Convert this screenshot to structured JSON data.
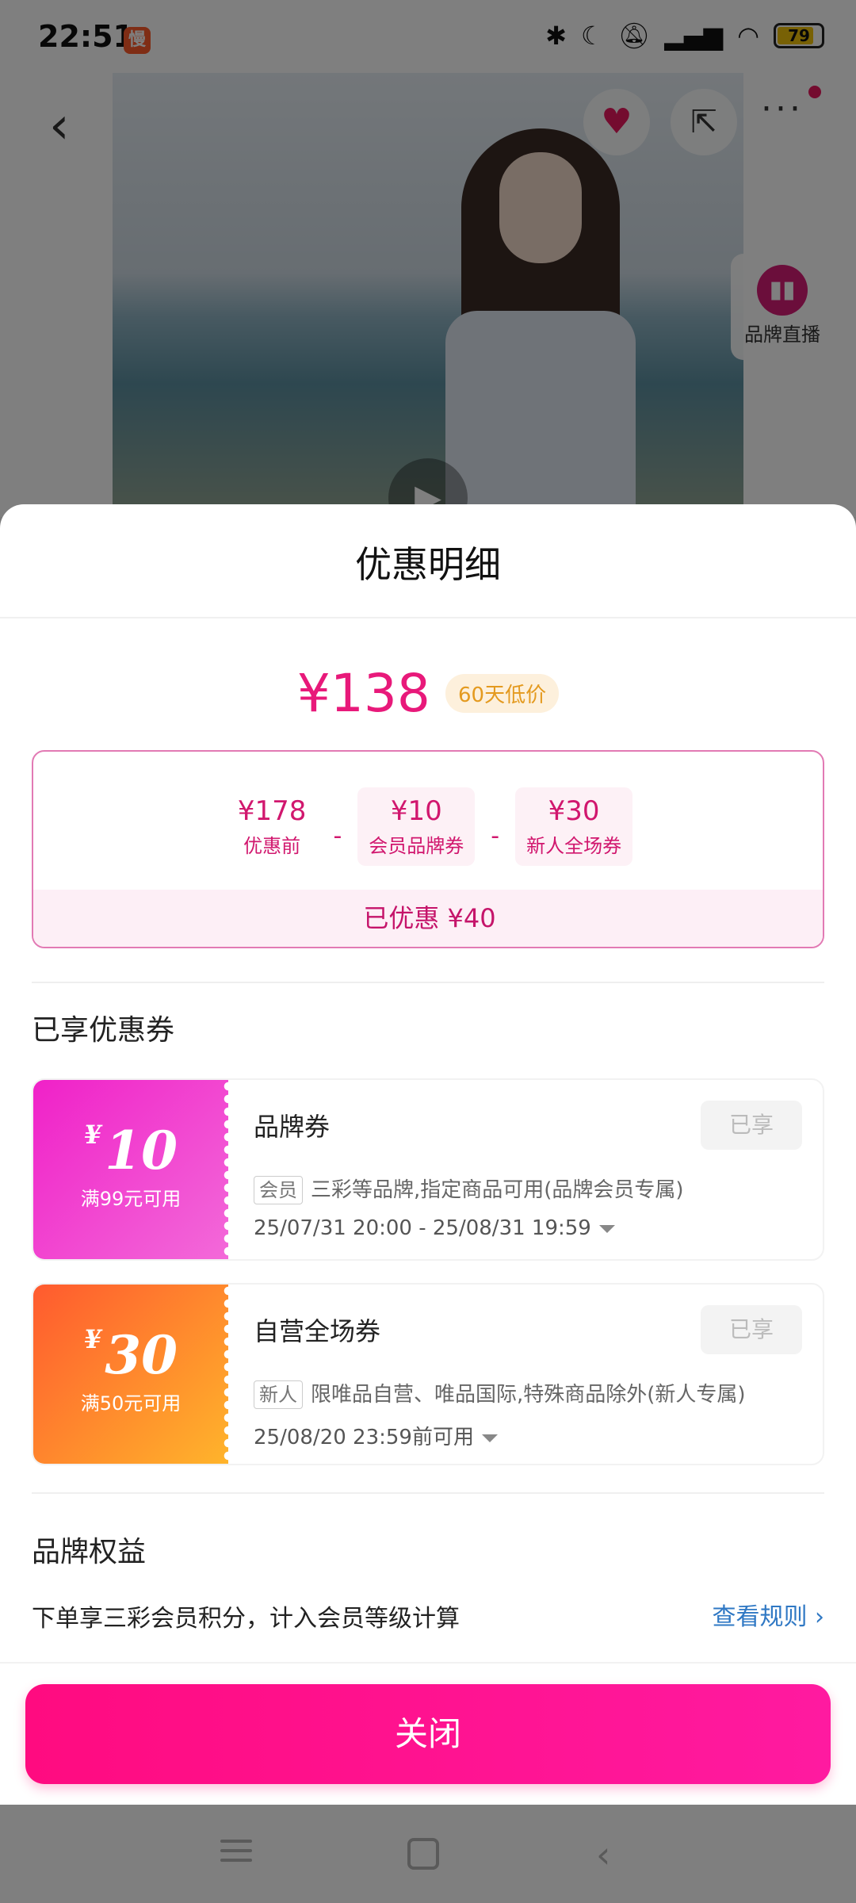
{
  "status_bar": {
    "time": "22:51",
    "app_badge": "慢",
    "battery": "79",
    "icons": [
      "bluetooth-icon",
      "moon-icon",
      "mute-icon",
      "signal-icon",
      "wifi-icon",
      "battery-icon"
    ]
  },
  "background_page": {
    "live_label": "品牌直播"
  },
  "sheet": {
    "title": "优惠明细",
    "final_price": "¥138",
    "price_tag": "60天低价",
    "breakdown": {
      "original_amount": "¥178",
      "original_label": "优惠前",
      "minus": "-",
      "coupon1_amount": "¥10",
      "coupon1_label": "会员品牌券",
      "coupon2_amount": "¥30",
      "coupon2_label": "新人全场券",
      "total_saved": "已优惠 ¥40"
    },
    "coupons_heading": "已享优惠券",
    "coupons": [
      {
        "currency": "¥",
        "value": "10",
        "condition": "满99元可用",
        "name": "品牌券",
        "status": "已享",
        "chip": "会员",
        "description": "三彩等品牌,指定商品可用(品牌会员专属)",
        "validity": "25/07/31 20:00 - 25/08/31 19:59"
      },
      {
        "currency": "¥",
        "value": "30",
        "condition": "满50元可用",
        "name": "自营全场券",
        "status": "已享",
        "chip": "新人",
        "description": "限唯品自营、唯品国际,特殊商品除外(新人专属)",
        "validity": "25/08/20 23:59前可用"
      }
    ],
    "rights_heading": "品牌权益",
    "rights_text": "下单享三彩会员积分，计入会员等级计算",
    "rights_link": "查看规则",
    "close_label": "关闭"
  },
  "colors": {
    "accent_pink": "#e8197a",
    "coupon1_gradient": "#f021c8",
    "coupon2_gradient": "#ff5a2f",
    "link_blue": "#2f78c4"
  }
}
